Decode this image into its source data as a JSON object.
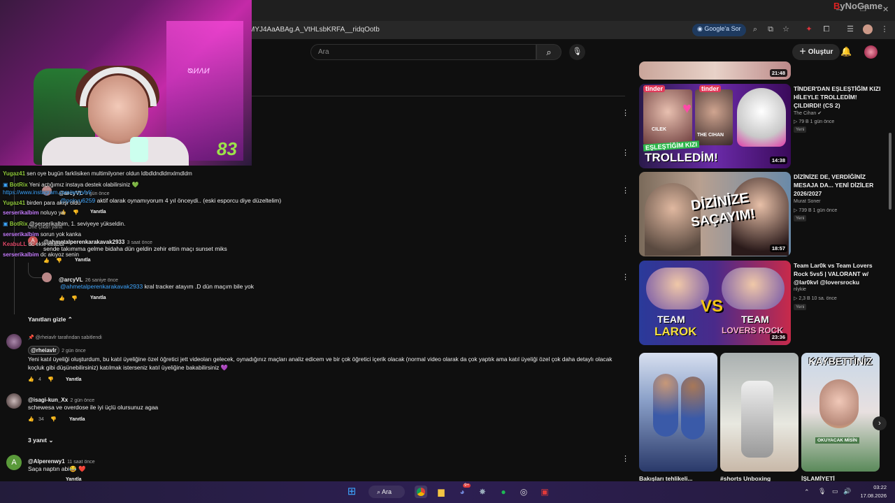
{
  "browser": {
    "url": "MYJ4AaABAg.A_VtHLsbKRFA__ridqOotb",
    "google_ask": "Google'a Sor",
    "brand_a": "B",
    "brand_b": "yNoGame"
  },
  "yt": {
    "search_placeholder": "Ara",
    "create_label": "Oluştur"
  },
  "overlay": {
    "score": "83",
    "sign": "ᴓᴎᴧᴎ"
  },
  "chat": [
    {
      "user": "Yugaz41",
      "text": "sen oye bugün farklisiken multimilyoner oldun ldbdldndldmxlmdldm",
      "color": "#8fc93a"
    },
    {
      "user": "BotRix",
      "text": "Yeni açtığımız instaya destek olabilirsiniz 💚",
      "color": "#8fc93a"
    },
    {
      "user": "",
      "text": "https://www.instagram.com/arcyvlvl/",
      "color": "#3ea6ff"
    },
    {
      "user": "Yugaz41",
      "text": "birden para akışı oldu",
      "color": "#8fc93a"
    },
    {
      "user": "serserikalbim",
      "text": "noluyo ya",
      "color": "#c77dff"
    },
    {
      "user": "BotRix",
      "text": "@serserikalbim, 1. seviyeye yükseldin.",
      "color": "#8fc93a"
    },
    {
      "user": "serserikalbim",
      "text": "sorun yok kanka",
      "color": "#c77dff"
    },
    {
      "user": "KeabuLL",
      "text": "dc ekle keabul",
      "color": "#e04a6a"
    },
    {
      "user": "serserikalbim",
      "text": "dc akıyoz senin",
      "color": "#c77dff"
    }
  ],
  "comments": [
    {
      "user": "@arcyVL",
      "time": "2 gün önce",
      "mention": "@pokvu6259",
      "text": "aktif olarak oynamıyorum 4 yıl önceydi.. (eski esporcu diye düzeltelim)",
      "reply": "Yanıtla",
      "note": "Öne çıkan yanıt"
    },
    {
      "user": "@ahmetalperenkarakavak2933",
      "time": "3 saat önce",
      "text": "sende takımıma gelme bidaha dün geldin  zehir ettin maçı sunset miks",
      "reply": "Yanıtla"
    },
    {
      "user": "@arcyVL",
      "time": "26 saniye önce",
      "mention": "@ahmetalperenkarakavak2933",
      "text": "kral tracker atayım .D dün maçım bile yok",
      "reply": "Yanıtla"
    },
    {
      "user": "@rheiavlr",
      "pinned": "@rheiavlr tarafından sabitlendi",
      "time": "2 gün önce",
      "text1": "Yeni katıl üyeliği oluşturdum, bu katıl üyeliğine özel öğretici jett videoları gelecek, oynadığınız maçları analiz edicem ve bir çok öğretici içerik olacak (normal video olarak da çok yaptık ama katıl üyeliği özel çok daha detaylı olacak",
      "text2": "koçluk gibi düşünebilirsiniz) katılmak isterseniz katıl üyeliğine bakabilirsiniz 💜",
      "likes": "4",
      "reply": "Yanıtla"
    },
    {
      "user": "@isagi-kun_Xx",
      "time": "2 gün önce",
      "text": "schewesa ve overdose ile iyi üçlü olursunuz agaa",
      "likes": "34",
      "reply": "Yanıtla"
    },
    {
      "user": "@Alperenwy1",
      "time": "11 saat önce",
      "text": "Saça naptın abi😂 ❤️",
      "reply": "Yanıtla",
      "avatar_letter": "A"
    }
  ],
  "hide_replies": "Yanıtları gizle",
  "replies_count": "3 yanıt",
  "videos": [
    {
      "title": "",
      "channel": "",
      "meta": "",
      "duration": "21:48"
    },
    {
      "title": "TİNDER'DAN EŞLEŞTİĞİM KIZI HİLEYLE TROLLEDİM! ÇILDIRDI! (CS 2)",
      "channel": "The Cihan",
      "meta": "▷ 79 B   1 gün önce",
      "badge": "Yeni",
      "duration": "14:38",
      "overlay1": "EŞLEŞTİĞİM KIZI",
      "overlay2": "TROLLEDİM!",
      "tag1": "tinder",
      "tag2": "tinder",
      "name2": "THE CIHAN",
      "name1": "CILEK"
    },
    {
      "title": "DİZİNİZE DE, VERDİĞİNİZ MESAJA DA... YENİ DİZİLER 2026/2027",
      "channel": "Murat Soner",
      "meta": "▷ 739 B   1 gün önce",
      "badge": "Yeni",
      "duration": "18:57",
      "overlay1": "DİZİNİZE",
      "overlay2": "SAÇAYIM!"
    },
    {
      "title": "Team Lar0k vs Team Lovers Rock 5vs5 | VALORANT w/ @lar0kvl @loversrocku",
      "channel": "nlykie",
      "meta": "▷ 2,3 B   10 sa. önce",
      "badge": "Yeni",
      "duration": "23:36",
      "overlay1": "TEAM",
      "overlay2": "LAROK",
      "overlay3": "TEAM",
      "overlay4": "LOVERS ROCK",
      "vs": "VS"
    }
  ],
  "shorts": [
    {
      "title": "Bakışları tehlikeli..."
    },
    {
      "title": "#shorts Unboxing"
    },
    {
      "title": "İŞLAMİYETİ",
      "overlay": "KAYBETTİNİZ",
      "caption": "OKUYACAK MİSİN"
    }
  ],
  "taskbar": {
    "search": "Ara",
    "time": "03:22",
    "date": "17.08.2026",
    "notif": "9+"
  }
}
